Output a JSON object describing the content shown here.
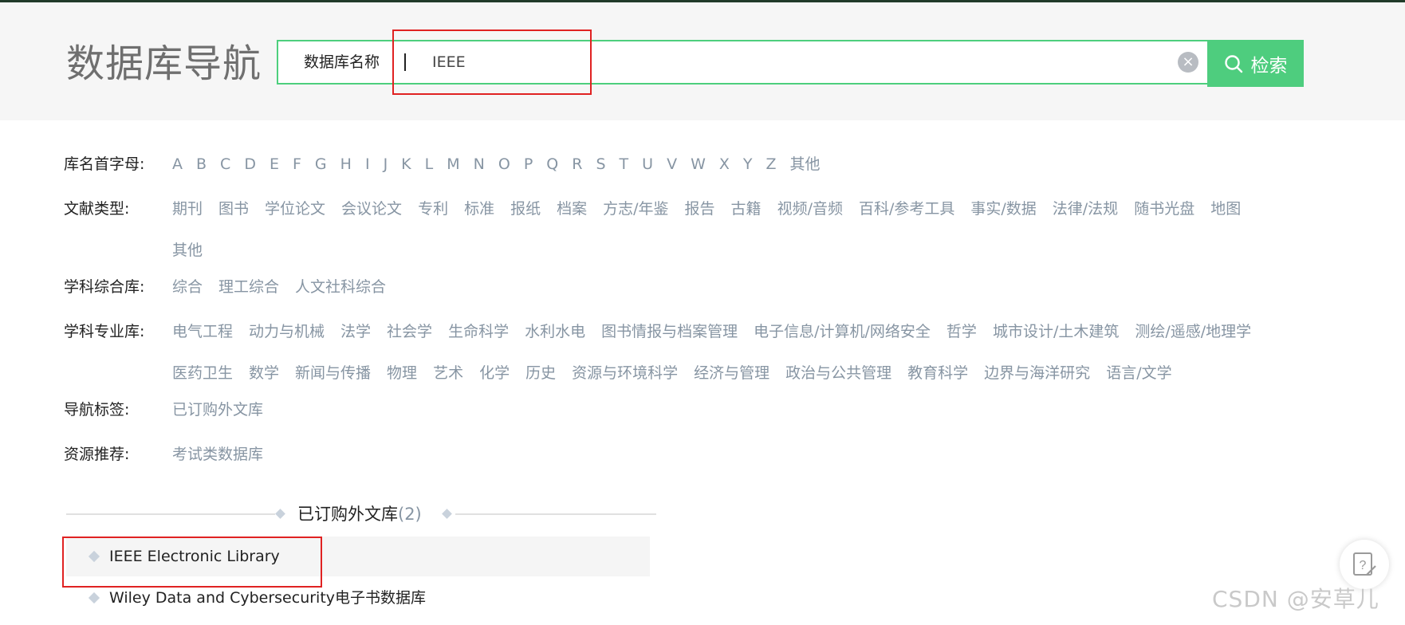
{
  "page_title": "数据库导航",
  "search": {
    "label": "数据库名称",
    "value": "IEEE",
    "clear_symbol": "×",
    "button_label": "检索"
  },
  "filters": {
    "letters": {
      "label": "库名首字母:",
      "items": [
        "A",
        "B",
        "C",
        "D",
        "E",
        "F",
        "G",
        "H",
        "I",
        "J",
        "K",
        "L",
        "M",
        "N",
        "O",
        "P",
        "Q",
        "R",
        "S",
        "T",
        "U",
        "V",
        "W",
        "X",
        "Y",
        "Z",
        "其他"
      ]
    },
    "doc_types": {
      "label": "文献类型:",
      "items": [
        "期刊",
        "图书",
        "学位论文",
        "会议论文",
        "专利",
        "标准",
        "报纸",
        "档案",
        "方志/年鉴",
        "报告",
        "古籍",
        "视频/音频",
        "百科/参考工具",
        "事实/数据",
        "法律/法规",
        "随书光盘",
        "地图",
        "其他"
      ]
    },
    "comprehensive": {
      "label": "学科综合库:",
      "items": [
        "综合",
        "理工综合",
        "人文社科综合"
      ]
    },
    "professional": {
      "label": "学科专业库:",
      "items": [
        "电气工程",
        "动力与机械",
        "法学",
        "社会学",
        "生命科学",
        "水利水电",
        "图书情报与档案管理",
        "电子信息/计算机/网络安全",
        "哲学",
        "城市设计/土木建筑",
        "测绘/遥感/地理学",
        "医药卫生",
        "数学",
        "新闻与传播",
        "物理",
        "艺术",
        "化学",
        "历史",
        "资源与环境科学",
        "经济与管理",
        "政治与公共管理",
        "教育科学",
        "边界与海洋研究",
        "语言/文学"
      ]
    },
    "nav_tags": {
      "label": "导航标签:",
      "items": [
        "已订购外文库"
      ]
    },
    "recommend": {
      "label": "资源推荐:",
      "items": [
        "考试类数据库"
      ]
    }
  },
  "results": {
    "section_title": "已订购外文库",
    "count": "(2)",
    "items": [
      {
        "name": "IEEE Electronic Library"
      },
      {
        "name": "Wiley Data and Cybersecurity电子书数据库"
      }
    ]
  },
  "watermark": "CSDN @安草儿",
  "colors": {
    "accent": "#4ecd7e",
    "link": "#8795a3",
    "highlight": "#e02222"
  }
}
